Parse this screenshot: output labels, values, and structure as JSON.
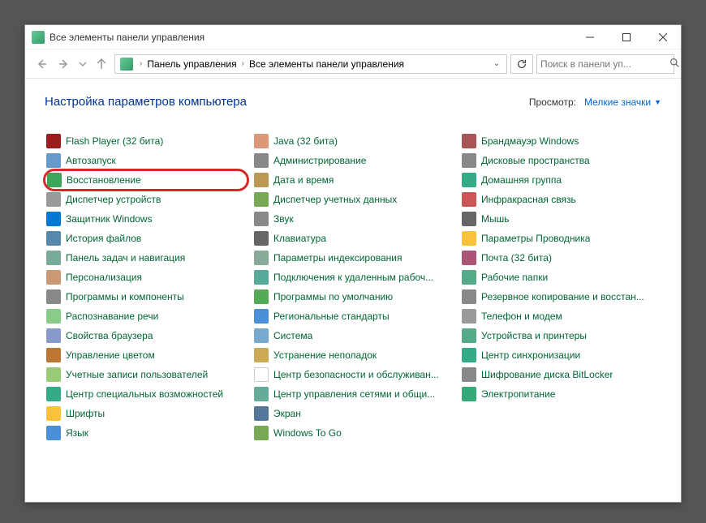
{
  "titlebar": {
    "title": "Все элементы панели управления"
  },
  "breadcrumb": {
    "part1": "Панель управления",
    "part2": "Все элементы панели управления"
  },
  "search": {
    "placeholder": "Поиск в панели уп..."
  },
  "header": {
    "title": "Настройка параметров компьютера",
    "view_label": "Просмотр:",
    "view_value": "Мелкие значки"
  },
  "items": [
    {
      "label": "Flash Player (32 бита)",
      "icon": "ic-flash",
      "hl": false
    },
    {
      "label": "Автозапуск",
      "icon": "ic-auto",
      "hl": false
    },
    {
      "label": "Восстановление",
      "icon": "ic-restore",
      "hl": true
    },
    {
      "label": "Диспетчер устройств",
      "icon": "ic-devmgr",
      "hl": false
    },
    {
      "label": "Защитник Windows",
      "icon": "ic-defender",
      "hl": false
    },
    {
      "label": "История файлов",
      "icon": "ic-history",
      "hl": false
    },
    {
      "label": "Панель задач и навигация",
      "icon": "ic-taskbar",
      "hl": false
    },
    {
      "label": "Персонализация",
      "icon": "ic-personal",
      "hl": false
    },
    {
      "label": "Программы и компоненты",
      "icon": "ic-prog",
      "hl": false
    },
    {
      "label": "Распознавание речи",
      "icon": "ic-speech",
      "hl": false
    },
    {
      "label": "Свойства браузера",
      "icon": "ic-browser",
      "hl": false
    },
    {
      "label": "Управление цветом",
      "icon": "ic-color",
      "hl": false
    },
    {
      "label": "Учетные записи пользователей",
      "icon": "ic-user",
      "hl": false
    },
    {
      "label": "Центр специальных возможностей",
      "icon": "ic-access",
      "hl": false
    },
    {
      "label": "Шрифты",
      "icon": "ic-fonts",
      "hl": false
    },
    {
      "label": "Язык",
      "icon": "ic-lang",
      "hl": false
    },
    {
      "label": "Java (32 бита)",
      "icon": "ic-java",
      "hl": false
    },
    {
      "label": "Администрирование",
      "icon": "ic-admin",
      "hl": false
    },
    {
      "label": "Дата и время",
      "icon": "ic-date",
      "hl": false
    },
    {
      "label": "Диспетчер учетных данных",
      "icon": "ic-cred",
      "hl": false
    },
    {
      "label": "Звук",
      "icon": "ic-sound",
      "hl": false
    },
    {
      "label": "Клавиатура",
      "icon": "ic-kbd",
      "hl": false
    },
    {
      "label": "Параметры индексирования",
      "icon": "ic-index",
      "hl": false
    },
    {
      "label": "Подключения к удаленным рабоч...",
      "icon": "ic-rdp",
      "hl": false
    },
    {
      "label": "Программы по умолчанию",
      "icon": "ic-default",
      "hl": false
    },
    {
      "label": "Региональные стандарты",
      "icon": "ic-region",
      "hl": false
    },
    {
      "label": "Система",
      "icon": "ic-system",
      "hl": false
    },
    {
      "label": "Устранение неполадок",
      "icon": "ic-trouble",
      "hl": false
    },
    {
      "label": "Центр безопасности и обслуживан...",
      "icon": "ic-sec",
      "hl": false
    },
    {
      "label": "Центр управления сетями и общи...",
      "icon": "ic-net",
      "hl": false
    },
    {
      "label": "Экран",
      "icon": "ic-screen",
      "hl": false
    },
    {
      "label": "Windows To Go",
      "icon": "ic-togo",
      "hl": false
    },
    {
      "label": "Брандмауэр Windows",
      "icon": "ic-fw",
      "hl": false
    },
    {
      "label": "Дисковые пространства",
      "icon": "ic-dates",
      "hl": false
    },
    {
      "label": "Домашняя группа",
      "icon": "ic-home",
      "hl": false
    },
    {
      "label": "Инфракрасная связь",
      "icon": "ic-ir",
      "hl": false
    },
    {
      "label": "Мышь",
      "icon": "ic-mouse",
      "hl": false
    },
    {
      "label": "Параметры Проводника",
      "icon": "ic-explorer",
      "hl": false
    },
    {
      "label": "Почта (32 бита)",
      "icon": "ic-mail",
      "hl": false
    },
    {
      "label": "Рабочие папки",
      "icon": "ic-work",
      "hl": false
    },
    {
      "label": "Резервное копирование и восстан...",
      "icon": "ic-backup",
      "hl": false
    },
    {
      "label": "Телефон и модем",
      "icon": "ic-tel",
      "hl": false
    },
    {
      "label": "Устройства и принтеры",
      "icon": "ic-devprint",
      "hl": false
    },
    {
      "label": "Центр синхронизации",
      "icon": "ic-sync",
      "hl": false
    },
    {
      "label": "Шифрование диска BitLocker",
      "icon": "ic-bitlocker",
      "hl": false
    },
    {
      "label": "Электропитание",
      "icon": "ic-power",
      "hl": false
    }
  ]
}
